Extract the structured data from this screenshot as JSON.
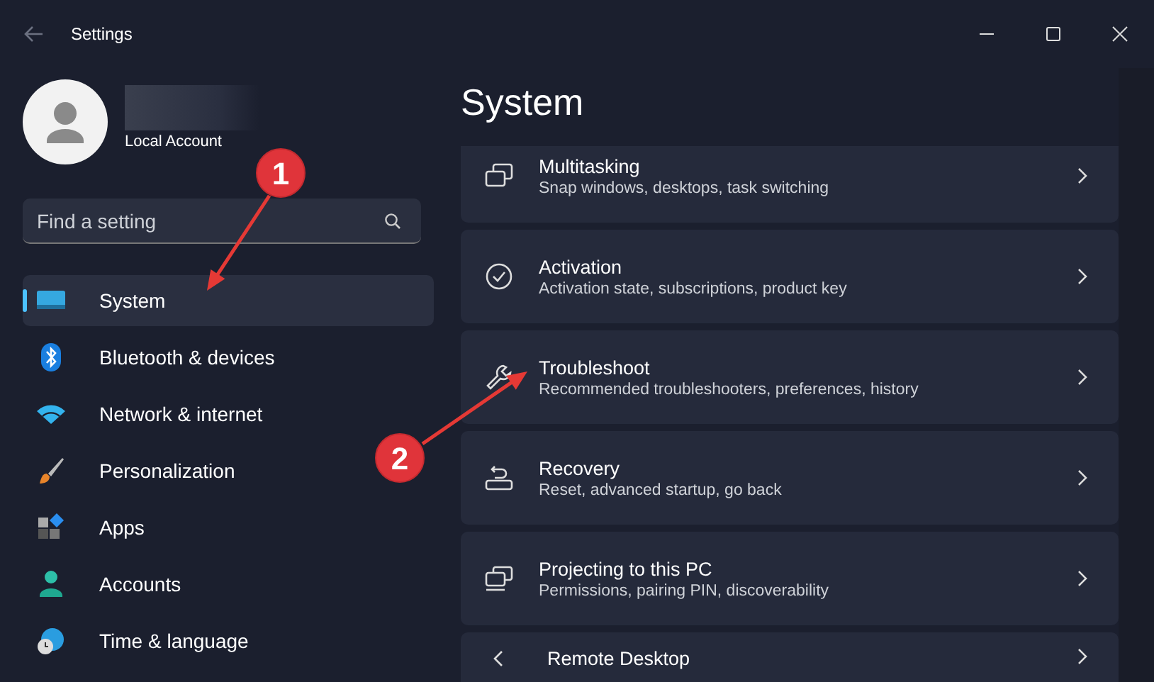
{
  "window": {
    "title": "Settings"
  },
  "profile": {
    "account_type": "Local Account"
  },
  "search": {
    "placeholder": "Find a setting"
  },
  "sidebar": {
    "items": [
      {
        "label": "System",
        "selected": true
      },
      {
        "label": "Bluetooth & devices",
        "selected": false
      },
      {
        "label": "Network & internet",
        "selected": false
      },
      {
        "label": "Personalization",
        "selected": false
      },
      {
        "label": "Apps",
        "selected": false
      },
      {
        "label": "Accounts",
        "selected": false
      },
      {
        "label": "Time & language",
        "selected": false
      }
    ]
  },
  "page": {
    "title": "System"
  },
  "cards": [
    {
      "title": "Multitasking",
      "subtitle": "Snap windows, desktops, task switching"
    },
    {
      "title": "Activation",
      "subtitle": "Activation state, subscriptions, product key"
    },
    {
      "title": "Troubleshoot",
      "subtitle": "Recommended troubleshooters, preferences, history"
    },
    {
      "title": "Recovery",
      "subtitle": "Reset, advanced startup, go back"
    },
    {
      "title": "Projecting to this PC",
      "subtitle": "Permissions, pairing PIN, discoverability"
    },
    {
      "title": "Remote Desktop"
    }
  ],
  "annotations": [
    {
      "label": "1"
    },
    {
      "label": "2"
    }
  ]
}
